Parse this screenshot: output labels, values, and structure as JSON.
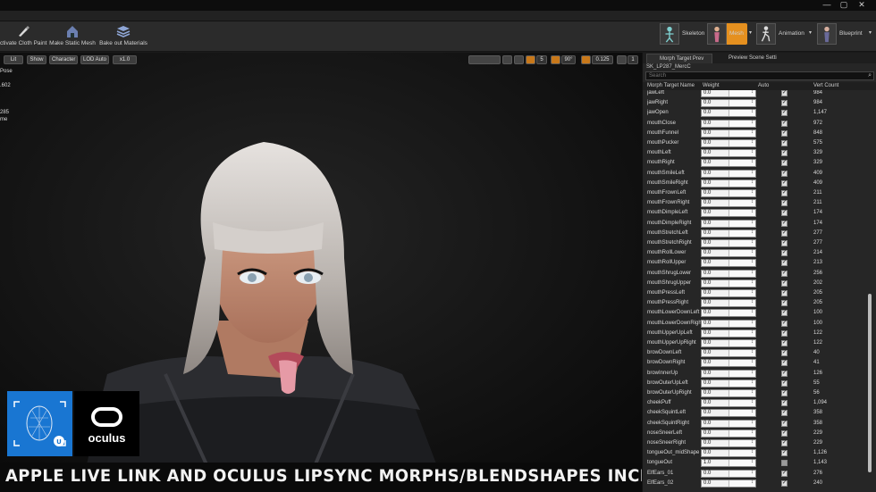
{
  "window": {
    "min_label": "—",
    "max_label": "▢",
    "close_label": "✕"
  },
  "toolbar": {
    "buttons": [
      {
        "label": "ctivate Cloth Paint"
      },
      {
        "label": "Make Static Mesh"
      },
      {
        "label": "Bake out Materials"
      }
    ],
    "modes": [
      {
        "label": "Skeleton"
      },
      {
        "label": "Mesh"
      },
      {
        "label": "Animation"
      },
      {
        "label": "Blueprint"
      }
    ],
    "accent": "#e5901f"
  },
  "viewport": {
    "buttons": {
      "lit": "Lit",
      "show": "Show",
      "character": "Character",
      "lod": "LOD Auto",
      "speed": "x1.0"
    },
    "snap_values": {
      "grid": "5",
      "angle": "90°",
      "scale": "0.125",
      "cam": "1"
    },
    "stats": {
      "pose": "Pose",
      "line1": ".602",
      "line2": "285",
      "line3": "me"
    }
  },
  "banner": {
    "text": "APPLE LIVE LINK AND OCULUS LIPSYNC MORPHS/BLENDSHAPES INCLUDING",
    "oculus": "oculus"
  },
  "panel": {
    "tabs": [
      {
        "label": "Morph Target Prev"
      },
      {
        "label": "Preview Scene Setti"
      }
    ],
    "mesh_name": "SK_LP287_MercC",
    "search_placeholder": "Search",
    "headers": {
      "name": "Morph Target Name",
      "weight": "Weight",
      "auto": "Auto",
      "vert": "Vert Count"
    },
    "rows": [
      {
        "name": "jawLeft",
        "weight": "0.0",
        "auto": true,
        "vert": "984"
      },
      {
        "name": "jawRight",
        "weight": "0.0",
        "auto": true,
        "vert": "984"
      },
      {
        "name": "jawOpen",
        "weight": "0.0",
        "auto": true,
        "vert": "1,147"
      },
      {
        "name": "mouthClose",
        "weight": "0.0",
        "auto": true,
        "vert": "972"
      },
      {
        "name": "mouthFunnel",
        "weight": "0.0",
        "auto": true,
        "vert": "848"
      },
      {
        "name": "mouthPucker",
        "weight": "0.0",
        "auto": true,
        "vert": "575"
      },
      {
        "name": "mouthLeft",
        "weight": "0.0",
        "auto": true,
        "vert": "329"
      },
      {
        "name": "mouthRight",
        "weight": "0.0",
        "auto": true,
        "vert": "329"
      },
      {
        "name": "mouthSmileLeft",
        "weight": "0.0",
        "auto": true,
        "vert": "409"
      },
      {
        "name": "mouthSmileRight",
        "weight": "0.0",
        "auto": true,
        "vert": "409"
      },
      {
        "name": "mouthFrownLeft",
        "weight": "0.0",
        "auto": true,
        "vert": "211"
      },
      {
        "name": "mouthFrownRight",
        "weight": "0.0",
        "auto": true,
        "vert": "211"
      },
      {
        "name": "mouthDimpleLeft",
        "weight": "0.0",
        "auto": true,
        "vert": "174"
      },
      {
        "name": "mouthDimpleRight",
        "weight": "0.0",
        "auto": true,
        "vert": "174"
      },
      {
        "name": "mouthStretchLeft",
        "weight": "0.0",
        "auto": true,
        "vert": "277"
      },
      {
        "name": "mouthStretchRight",
        "weight": "0.0",
        "auto": true,
        "vert": "277"
      },
      {
        "name": "mouthRollLower",
        "weight": "0.0",
        "auto": true,
        "vert": "214"
      },
      {
        "name": "mouthRollUpper",
        "weight": "0.0",
        "auto": true,
        "vert": "213"
      },
      {
        "name": "mouthShrugLower",
        "weight": "0.0",
        "auto": true,
        "vert": "256"
      },
      {
        "name": "mouthShrugUpper",
        "weight": "0.0",
        "auto": true,
        "vert": "202"
      },
      {
        "name": "mouthPressLeft",
        "weight": "0.0",
        "auto": true,
        "vert": "205"
      },
      {
        "name": "mouthPressRight",
        "weight": "0.0",
        "auto": true,
        "vert": "205"
      },
      {
        "name": "mouthLowerDownLeft",
        "weight": "0.0",
        "auto": true,
        "vert": "100"
      },
      {
        "name": "mouthLowerDownRight",
        "weight": "0.0",
        "auto": true,
        "vert": "100"
      },
      {
        "name": "mouthUpperUpLeft",
        "weight": "0.0",
        "auto": true,
        "vert": "122"
      },
      {
        "name": "mouthUpperUpRight",
        "weight": "0.0",
        "auto": true,
        "vert": "122"
      },
      {
        "name": "browDownLeft",
        "weight": "0.0",
        "auto": true,
        "vert": "40"
      },
      {
        "name": "browDownRight",
        "weight": "0.0",
        "auto": true,
        "vert": "41"
      },
      {
        "name": "browInnerUp",
        "weight": "0.0",
        "auto": true,
        "vert": "126"
      },
      {
        "name": "browOuterUpLeft",
        "weight": "0.0",
        "auto": true,
        "vert": "55"
      },
      {
        "name": "browOuterUpRight",
        "weight": "0.0",
        "auto": true,
        "vert": "56"
      },
      {
        "name": "cheekPuff",
        "weight": "0.0",
        "auto": true,
        "vert": "1,094"
      },
      {
        "name": "cheekSquintLeft",
        "weight": "0.0",
        "auto": true,
        "vert": "358"
      },
      {
        "name": "cheekSquintRight",
        "weight": "0.0",
        "auto": true,
        "vert": "358"
      },
      {
        "name": "noseSneerLeft",
        "weight": "0.0",
        "auto": true,
        "vert": "229"
      },
      {
        "name": "noseSneerRight",
        "weight": "0.0",
        "auto": true,
        "vert": "229"
      },
      {
        "name": "tongueOut_midShape",
        "weight": "0.0",
        "auto": true,
        "vert": "1,126"
      },
      {
        "name": "tongueOut",
        "weight": "1.0",
        "auto": false,
        "vert": "1,143"
      },
      {
        "name": "ElfEars_01",
        "weight": "0.0",
        "auto": true,
        "vert": "276"
      },
      {
        "name": "ElfEars_02",
        "weight": "0.0",
        "auto": true,
        "vert": "240"
      }
    ]
  }
}
